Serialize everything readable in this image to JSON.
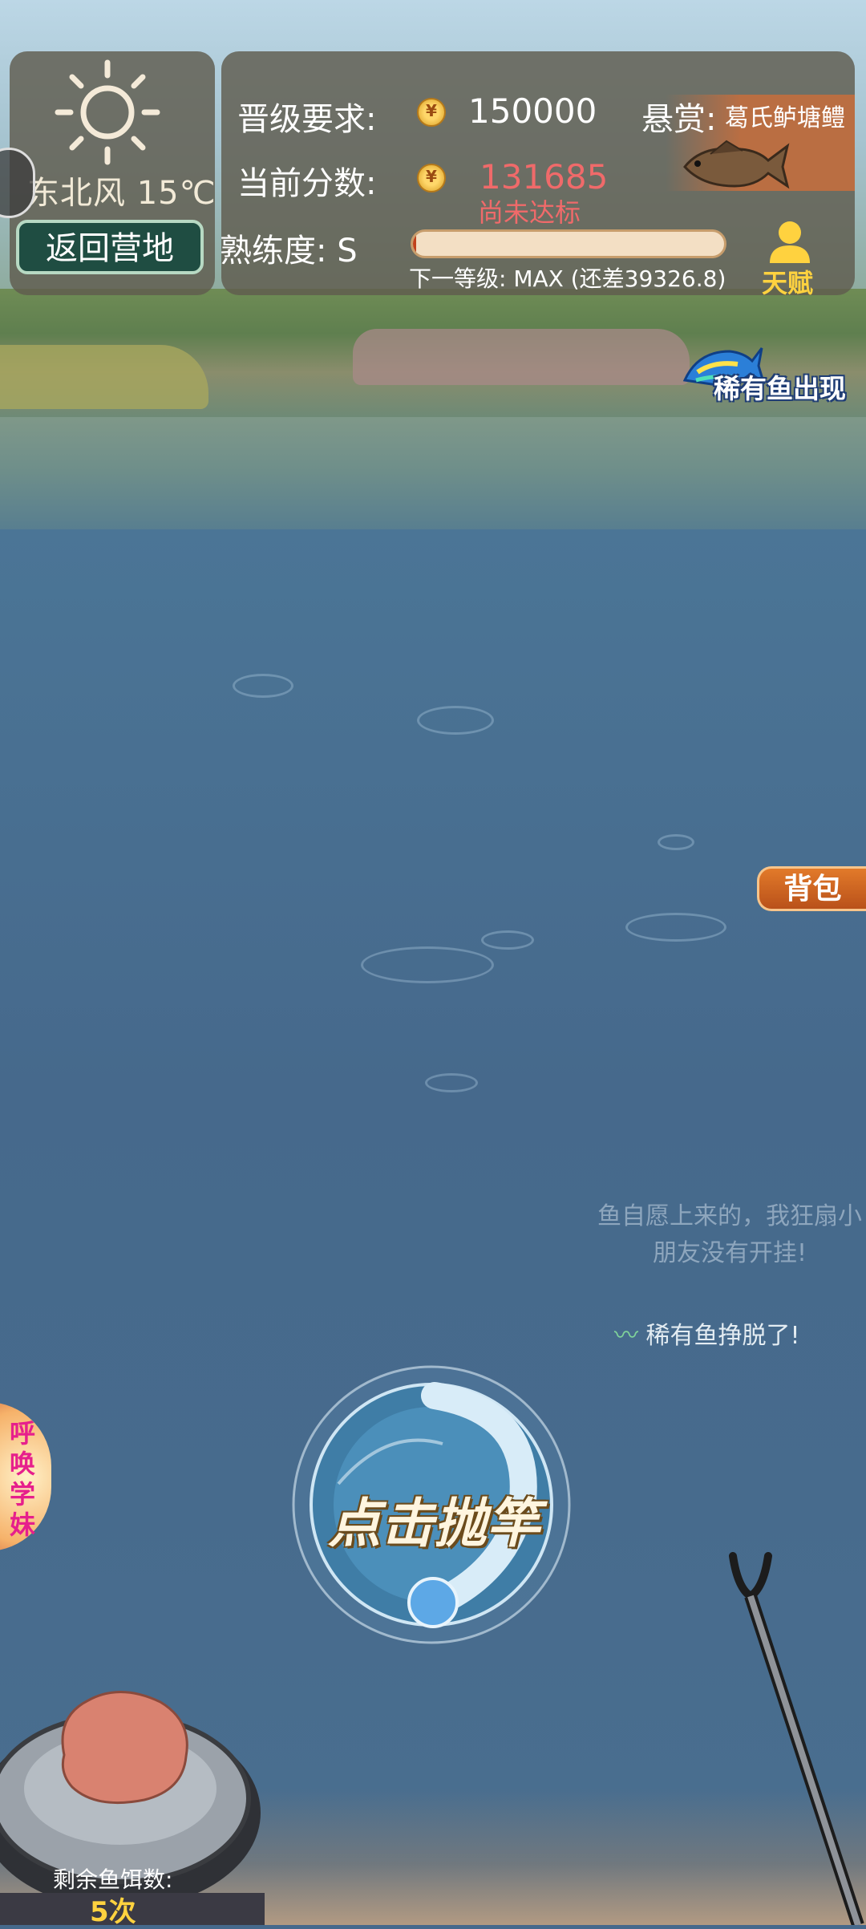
{
  "weather": {
    "wind_temp": "东北风 15℃",
    "return_label": "返回营地"
  },
  "stats": {
    "req_label": "晋级要求:",
    "req_value": "150000",
    "score_label": "当前分数:",
    "score_value": "131685",
    "score_status": "尚未达标",
    "skill_label": "熟练度: S",
    "skill_progress": 0.01,
    "next_level": "下一等级: MAX (还差39326.8)"
  },
  "bounty": {
    "label": "悬赏:",
    "fish": "葛氏鲈塘鳢"
  },
  "talent": {
    "label": "天赋"
  },
  "rare": {
    "banner": "稀有鱼出现"
  },
  "bag": {
    "label": "背包"
  },
  "messages": {
    "dim": "鱼自愿上来的，我狂扇小朋友没有开挂!",
    "escape": "稀有鱼挣脱了!"
  },
  "cast": {
    "label": "点击抛竿"
  },
  "summon": {
    "label": "呼唤学妹"
  },
  "bait": {
    "label": "剩余鱼饵数:",
    "count": "5次"
  },
  "colors": {
    "panel": "#5f5c4e",
    "score_red": "#f06a6a",
    "gold": "#ffd23f",
    "bag_orange": "#d5661f",
    "water": "#46698c"
  }
}
